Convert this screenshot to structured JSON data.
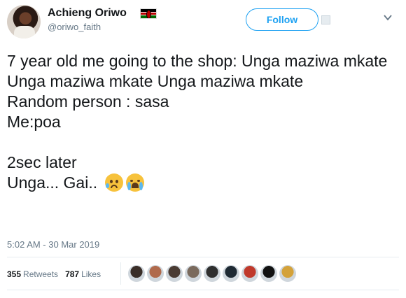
{
  "user": {
    "name": "Achieng Oriwo",
    "handle": "@oriwo_faith"
  },
  "actions": {
    "follow_label": "Follow"
  },
  "tweet": {
    "text": "7 year old me going to the shop: Unga maziwa mkate Unga maziwa mkate Unga maziwa mkate\nRandom person : sasa\nMe:poa\n\n2sec later\nUnga... Gai..",
    "emojis": [
      "anxious-face-with-sweat",
      "loudly-crying-face"
    ],
    "timestamp": "5:02 AM - 30 Mar 2019"
  },
  "stats": {
    "retweets_count": "355",
    "retweets_label": "Retweets",
    "likes_count": "787",
    "likes_label": "Likes"
  },
  "likers": [
    {
      "color": "#3a2e28"
    },
    {
      "color": "#b06a4c"
    },
    {
      "color": "#4a3b33"
    },
    {
      "color": "#7a6a5d"
    },
    {
      "color": "#2f2f2f"
    },
    {
      "color": "#1f2a33"
    },
    {
      "color": "#c0392b"
    },
    {
      "color": "#111111"
    },
    {
      "color": "#d4a23a"
    }
  ],
  "colors": {
    "accent": "#1da1f2",
    "muted": "#657786",
    "text": "#14171a"
  }
}
